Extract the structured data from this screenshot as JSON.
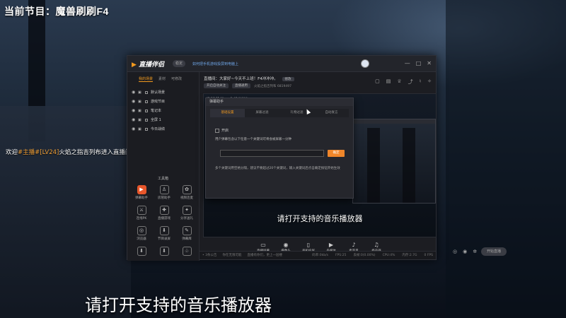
{
  "stream": {
    "top_title": "当前节目：魔兽刷刷F4",
    "welcome_prefix": "欢迎",
    "welcome_tag": "#主播#[LV24]",
    "welcome_rest": "火焰之指吉列布进入直播间",
    "bottom_caption": "请打开支持的音乐播放器"
  },
  "app": {
    "logo_text": "直播伴侣",
    "version_label": "稳定",
    "title_link": "如何把手机游戏投屏到电脑上",
    "window_controls": [
      "—",
      "□",
      "✕"
    ]
  },
  "sidebar": {
    "tabs": [
      "我的场景",
      "素材",
      "可修改"
    ],
    "scenes": [
      "默认场景",
      "游戏节目",
      "笔记本",
      "全屏 1",
      "今日战绩"
    ],
    "tools_title": "工具箱",
    "tools": [
      {
        "label": "弹幕助手",
        "icon": "▶"
      },
      {
        "label": "房管助手",
        "icon": "♙"
      },
      {
        "label": "视频连麦",
        "icon": "✿"
      },
      {
        "label": "连线PK",
        "icon": "⚔"
      },
      {
        "label": "直播游戏",
        "icon": "✚"
      },
      {
        "label": "分享送礼",
        "icon": "✦"
      },
      {
        "label": "浏览器",
        "icon": "◎"
      },
      {
        "label": "节目录屏",
        "icon": "⬇"
      },
      {
        "label": "弹幕库",
        "icon": "✎"
      },
      {
        "label": "",
        "icon": "⬇"
      },
      {
        "label": "",
        "icon": "⬇"
      },
      {
        "label": "",
        "icon": "♧"
      }
    ]
  },
  "main": {
    "notice": "直播间：大家好~今天不上班！F4冲冲冲。",
    "notice_pill": "修改",
    "sub_pills": [
      "开启自动关注",
      "直播通用"
    ],
    "sub_text": "火焰之指吉列布  6819497",
    "preview_title": "当前节目：魔兽刷刷F4",
    "preview_caption": "请打开支持的音乐播放器"
  },
  "dialog": {
    "header": "弹幕助手",
    "tabs": [
      "基础设置",
      "屏蔽过滤",
      "礼物过滤",
      "自动发言"
    ],
    "active_tab": 0,
    "checkbox_label": "开启",
    "description": "用户弹幕包含以下任意一个关键词可将会被屏蔽一分钟",
    "input_value": "",
    "button_label": "确定",
    "note": "多个关键词用空格分隔，建议不要超过20个关键词，输入关键词后点击确定按钮开始生效"
  },
  "toolbar": {
    "items": [
      {
        "label": "直播屏幕",
        "icon": "▭"
      },
      {
        "label": "摄像头",
        "icon": "◉"
      },
      {
        "label": "手机投屏",
        "icon": "▯"
      },
      {
        "label": "多媒体",
        "icon": "▶"
      },
      {
        "label": "麦克风",
        "icon": "♪"
      },
      {
        "label": "扬声器",
        "icon": "♫"
      }
    ],
    "start_label": "开始直播"
  },
  "statusbar": {
    "left": [
      "• 3条公告",
      "你在无限可能",
      "直播有你们，更上一层楼"
    ],
    "right": [
      "码率:0kb/s",
      "FPS:25",
      "丢帧:0(0.00%)",
      "CPU:4%",
      "内存:2.7G",
      "0 FPS"
    ]
  }
}
